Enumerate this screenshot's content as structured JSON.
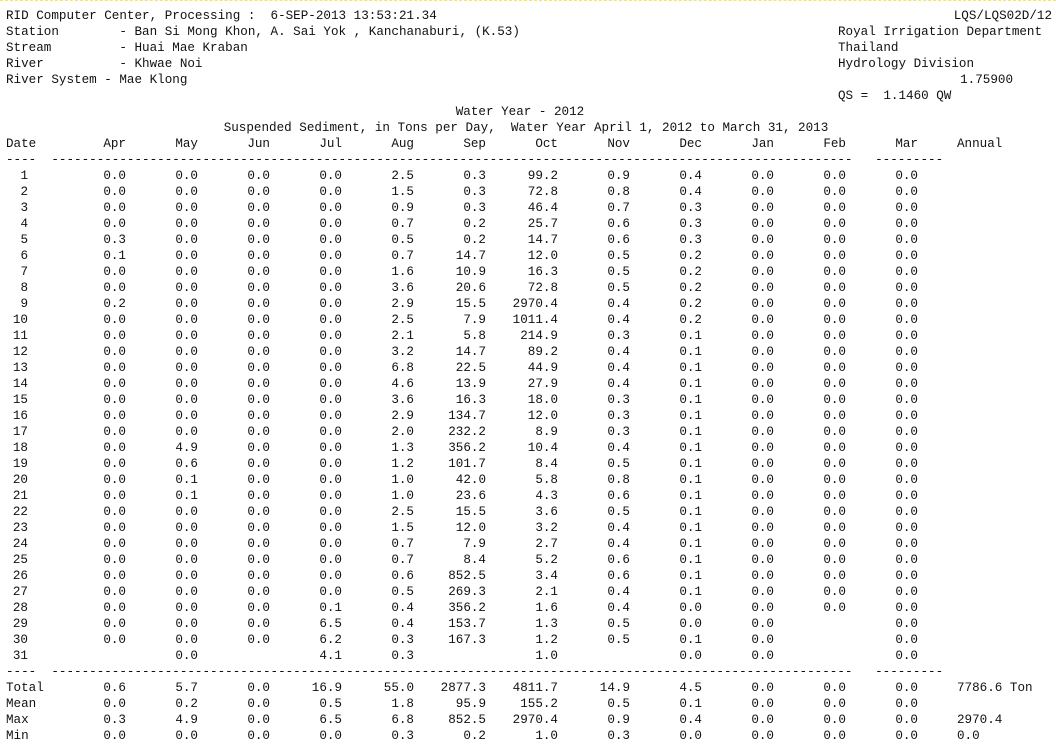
{
  "header": {
    "processing": "RID Computer Center, Processing :  6-SEP-2013 13:53:21.34",
    "report_code": "LQS/LQS02D/12",
    "station": "Station        - Ban Si Mong Khon, A. Sai Yok , Kanchanaburi, (K.53)",
    "stream": "Stream         - Huai Mae Kraban",
    "river": "River          - Khwae Noi",
    "river_system": "River System - Mae Klong",
    "department": "Royal Irrigation Department",
    "country": "Thailand",
    "division": "Hydrology Division",
    "coefficient": "1.75900",
    "formula": "QS =  1.1460 QW"
  },
  "titles": {
    "water_year": "Water Year - 2012",
    "subtitle": "Suspended Sediment, in Tons per Day,  Water Year April 1, 2012 to March 31, 2013"
  },
  "columns": [
    "Date",
    "Apr",
    "May",
    "Jun",
    "Jul",
    "Aug",
    "Sep",
    "Oct",
    "Nov",
    "Dec",
    "Jan",
    "Feb",
    "Mar",
    "Annual"
  ],
  "rule_top": "----  ----------------------------------------------------------------------------------------------------------   ---------",
  "rule_bottom": "----  ----------------------------------------------------------------------------------------------------------   ---------",
  "rows": [
    [
      "1",
      "0.0",
      "0.0",
      "0.0",
      "0.0",
      "2.5",
      "0.3",
      "99.2",
      "0.9",
      "0.4",
      "0.0",
      "0.0",
      "0.0"
    ],
    [
      "2",
      "0.0",
      "0.0",
      "0.0",
      "0.0",
      "1.5",
      "0.3",
      "72.8",
      "0.8",
      "0.4",
      "0.0",
      "0.0",
      "0.0"
    ],
    [
      "3",
      "0.0",
      "0.0",
      "0.0",
      "0.0",
      "0.9",
      "0.3",
      "46.4",
      "0.7",
      "0.3",
      "0.0",
      "0.0",
      "0.0"
    ],
    [
      "4",
      "0.0",
      "0.0",
      "0.0",
      "0.0",
      "0.7",
      "0.2",
      "25.7",
      "0.6",
      "0.3",
      "0.0",
      "0.0",
      "0.0"
    ],
    [
      "5",
      "0.3",
      "0.0",
      "0.0",
      "0.0",
      "0.5",
      "0.2",
      "14.7",
      "0.6",
      "0.3",
      "0.0",
      "0.0",
      "0.0"
    ],
    [
      "6",
      "0.1",
      "0.0",
      "0.0",
      "0.0",
      "0.7",
      "14.7",
      "12.0",
      "0.5",
      "0.2",
      "0.0",
      "0.0",
      "0.0"
    ],
    [
      "7",
      "0.0",
      "0.0",
      "0.0",
      "0.0",
      "1.6",
      "10.9",
      "16.3",
      "0.5",
      "0.2",
      "0.0",
      "0.0",
      "0.0"
    ],
    [
      "8",
      "0.0",
      "0.0",
      "0.0",
      "0.0",
      "3.6",
      "20.6",
      "72.8",
      "0.5",
      "0.2",
      "0.0",
      "0.0",
      "0.0"
    ],
    [
      "9",
      "0.2",
      "0.0",
      "0.0",
      "0.0",
      "2.9",
      "15.5",
      "2970.4",
      "0.4",
      "0.2",
      "0.0",
      "0.0",
      "0.0"
    ],
    [
      "10",
      "0.0",
      "0.0",
      "0.0",
      "0.0",
      "2.5",
      "7.9",
      "1011.4",
      "0.4",
      "0.2",
      "0.0",
      "0.0",
      "0.0"
    ],
    [
      "11",
      "0.0",
      "0.0",
      "0.0",
      "0.0",
      "2.1",
      "5.8",
      "214.9",
      "0.3",
      "0.1",
      "0.0",
      "0.0",
      "0.0"
    ],
    [
      "12",
      "0.0",
      "0.0",
      "0.0",
      "0.0",
      "3.2",
      "14.7",
      "89.2",
      "0.4",
      "0.1",
      "0.0",
      "0.0",
      "0.0"
    ],
    [
      "13",
      "0.0",
      "0.0",
      "0.0",
      "0.0",
      "6.8",
      "22.5",
      "44.9",
      "0.4",
      "0.1",
      "0.0",
      "0.0",
      "0.0"
    ],
    [
      "14",
      "0.0",
      "0.0",
      "0.0",
      "0.0",
      "4.6",
      "13.9",
      "27.9",
      "0.4",
      "0.1",
      "0.0",
      "0.0",
      "0.0"
    ],
    [
      "15",
      "0.0",
      "0.0",
      "0.0",
      "0.0",
      "3.6",
      "16.3",
      "18.0",
      "0.3",
      "0.1",
      "0.0",
      "0.0",
      "0.0"
    ],
    [
      "16",
      "0.0",
      "0.0",
      "0.0",
      "0.0",
      "2.9",
      "134.7",
      "12.0",
      "0.3",
      "0.1",
      "0.0",
      "0.0",
      "0.0"
    ],
    [
      "17",
      "0.0",
      "0.0",
      "0.0",
      "0.0",
      "2.0",
      "232.2",
      "8.9",
      "0.3",
      "0.1",
      "0.0",
      "0.0",
      "0.0"
    ],
    [
      "18",
      "0.0",
      "4.9",
      "0.0",
      "0.0",
      "1.3",
      "356.2",
      "10.4",
      "0.4",
      "0.1",
      "0.0",
      "0.0",
      "0.0"
    ],
    [
      "19",
      "0.0",
      "0.6",
      "0.0",
      "0.0",
      "1.2",
      "101.7",
      "8.4",
      "0.5",
      "0.1",
      "0.0",
      "0.0",
      "0.0"
    ],
    [
      "20",
      "0.0",
      "0.1",
      "0.0",
      "0.0",
      "1.0",
      "42.0",
      "5.8",
      "0.8",
      "0.1",
      "0.0",
      "0.0",
      "0.0"
    ],
    [
      "21",
      "0.0",
      "0.1",
      "0.0",
      "0.0",
      "1.0",
      "23.6",
      "4.3",
      "0.6",
      "0.1",
      "0.0",
      "0.0",
      "0.0"
    ],
    [
      "22",
      "0.0",
      "0.0",
      "0.0",
      "0.0",
      "2.5",
      "15.5",
      "3.6",
      "0.5",
      "0.1",
      "0.0",
      "0.0",
      "0.0"
    ],
    [
      "23",
      "0.0",
      "0.0",
      "0.0",
      "0.0",
      "1.5",
      "12.0",
      "3.2",
      "0.4",
      "0.1",
      "0.0",
      "0.0",
      "0.0"
    ],
    [
      "24",
      "0.0",
      "0.0",
      "0.0",
      "0.0",
      "0.7",
      "7.9",
      "2.7",
      "0.4",
      "0.1",
      "0.0",
      "0.0",
      "0.0"
    ],
    [
      "25",
      "0.0",
      "0.0",
      "0.0",
      "0.0",
      "0.7",
      "8.4",
      "5.2",
      "0.6",
      "0.1",
      "0.0",
      "0.0",
      "0.0"
    ],
    [
      "26",
      "0.0",
      "0.0",
      "0.0",
      "0.0",
      "0.6",
      "852.5",
      "3.4",
      "0.6",
      "0.1",
      "0.0",
      "0.0",
      "0.0"
    ],
    [
      "27",
      "0.0",
      "0.0",
      "0.0",
      "0.0",
      "0.5",
      "269.3",
      "2.1",
      "0.4",
      "0.1",
      "0.0",
      "0.0",
      "0.0"
    ],
    [
      "28",
      "0.0",
      "0.0",
      "0.0",
      "0.1",
      "0.4",
      "356.2",
      "1.6",
      "0.4",
      "0.0",
      "0.0",
      "0.0",
      "0.0"
    ],
    [
      "29",
      "0.0",
      "0.0",
      "0.0",
      "6.5",
      "0.4",
      "153.7",
      "1.3",
      "0.5",
      "0.0",
      "0.0",
      "",
      "0.0"
    ],
    [
      "30",
      "0.0",
      "0.0",
      "0.0",
      "6.2",
      "0.3",
      "167.3",
      "1.2",
      "0.5",
      "0.1",
      "0.0",
      "",
      "0.0"
    ],
    [
      "31",
      "",
      "0.0",
      "",
      "4.1",
      "0.3",
      "",
      "1.0",
      "",
      "0.0",
      "0.0",
      "",
      "0.0"
    ]
  ],
  "summary": [
    [
      "Total",
      "0.6",
      "5.7",
      "0.0",
      "16.9",
      "55.0",
      "2877.3",
      "4811.7",
      "14.9",
      "4.5",
      "0.0",
      "0.0",
      "0.0",
      "7786.6 Ton"
    ],
    [
      "Mean",
      "0.0",
      "0.2",
      "0.0",
      "0.5",
      "1.8",
      "95.9",
      "155.2",
      "0.5",
      "0.1",
      "0.0",
      "0.0",
      "0.0",
      ""
    ],
    [
      "Max",
      "0.3",
      "4.9",
      "0.0",
      "6.5",
      "6.8",
      "852.5",
      "2970.4",
      "0.9",
      "0.4",
      "0.0",
      "0.0",
      "0.0",
      "2970.4"
    ],
    [
      "Min",
      "0.0",
      "0.0",
      "0.0",
      "0.0",
      "0.3",
      "0.2",
      "1.0",
      "0.3",
      "0.0",
      "0.0",
      "0.0",
      "0.0",
      "0.0"
    ]
  ]
}
